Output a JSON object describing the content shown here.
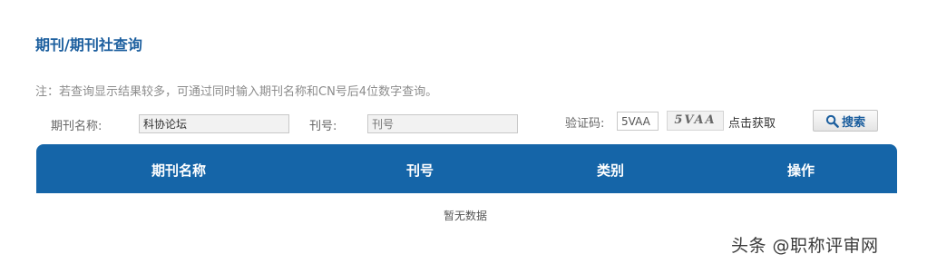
{
  "page": {
    "title": "期刊/期刊社查询",
    "notice": "注：若查询显示结果较多，可通过同时输入期刊名称和CN号后4位数字查询。"
  },
  "search_form": {
    "journal_name_label": "期刊名称:",
    "journal_name_value": "科协论坛",
    "issue_label": "刊号:",
    "issue_placeholder": "刊号",
    "captcha_label": "验证码:",
    "captcha_value": "5VAA",
    "captcha_image_text": "5VAA",
    "refresh_label": "点击获取",
    "search_button_label": "搜索"
  },
  "results_table": {
    "columns": [
      "期刊名称",
      "刊号",
      "类别",
      "操作"
    ],
    "empty_text": "暂无数据"
  },
  "watermark": "头条 @职称评审网",
  "colors": {
    "brand_blue": "#1565a8",
    "title_blue": "#1b5e9e"
  }
}
